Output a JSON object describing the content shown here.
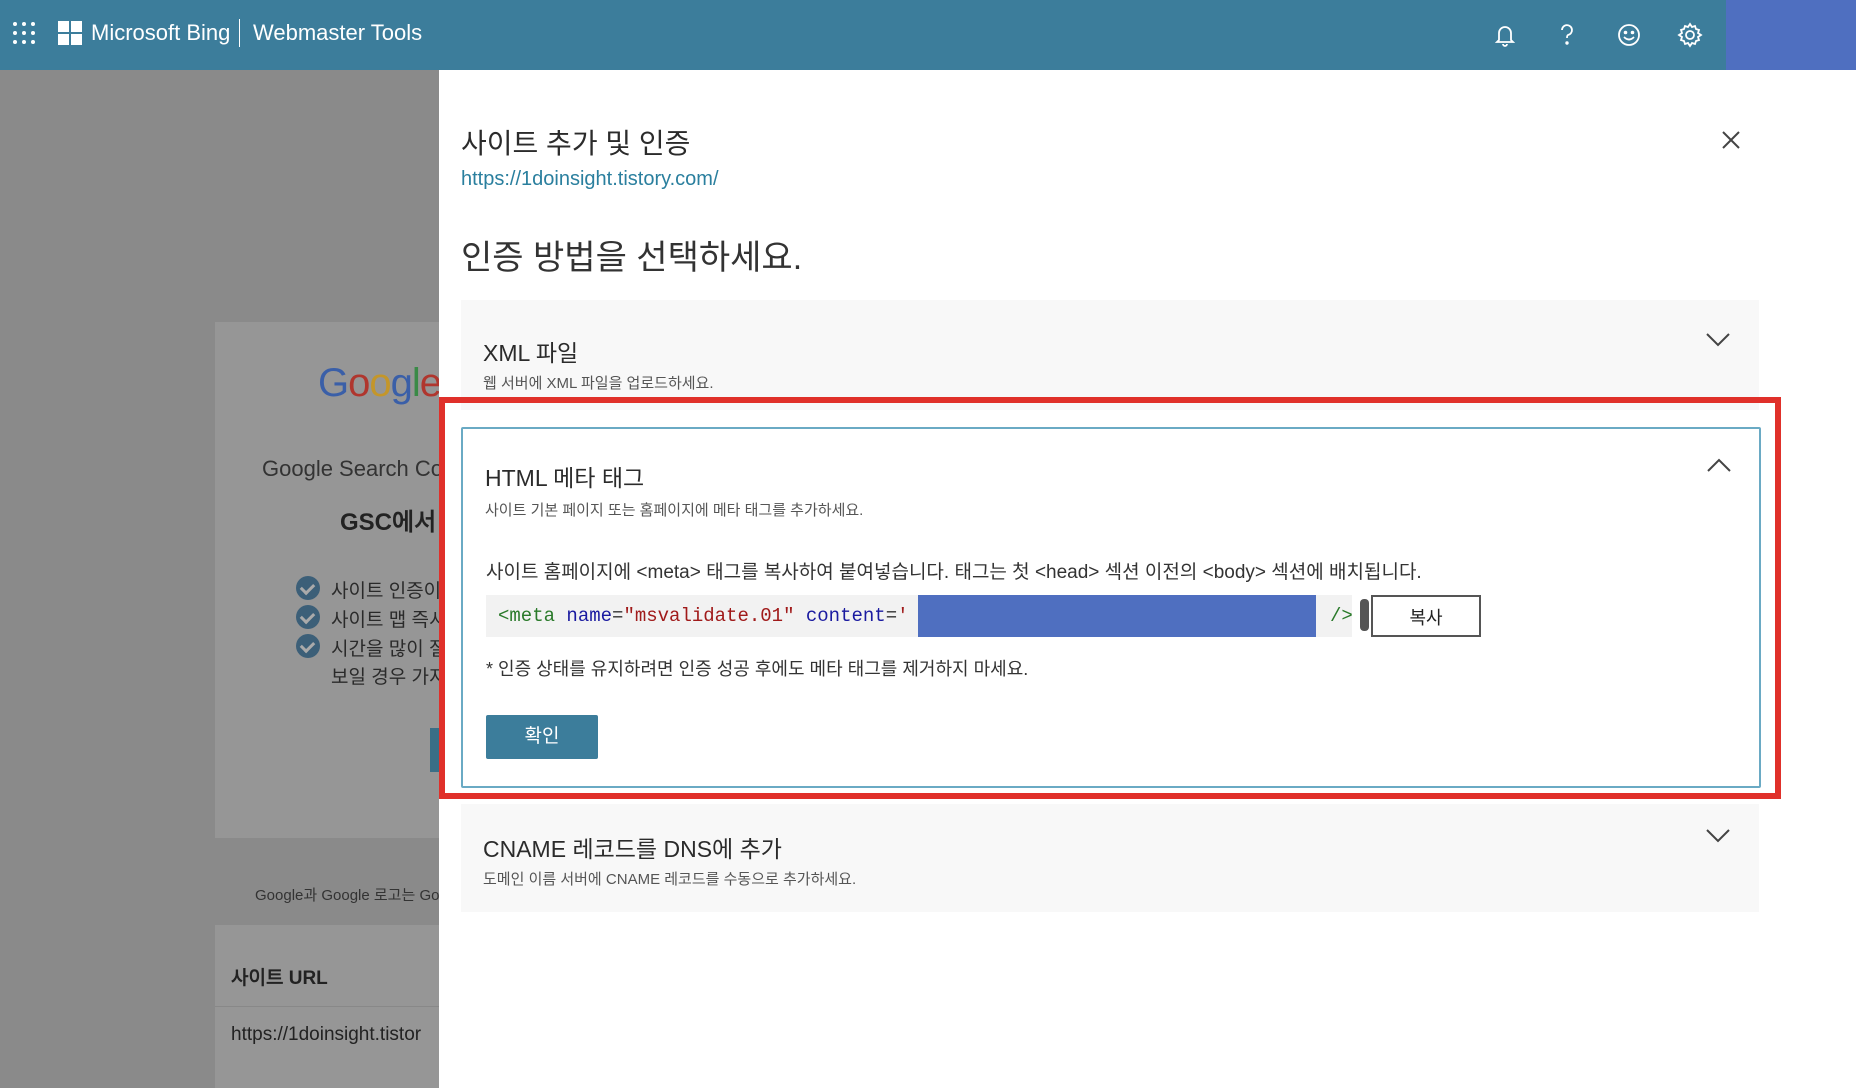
{
  "topbar": {
    "brand": "Microsoft Bing",
    "product": "Webmaster Tools",
    "icons": [
      "waffle-icon",
      "bell-icon",
      "help-icon",
      "smiley-icon",
      "gear-icon"
    ],
    "color": "#3c7d9b"
  },
  "background": {
    "google_logo": "Google",
    "gsc_title": "Google Search Co",
    "gsc_subtitle": "GSC에서",
    "bullets": [
      "사이트 인증이",
      "사이트 맵 즉시",
      "시간을 많이 절",
      "보일 경우 가져"
    ],
    "footer": "Google과 Google 로고는 Go",
    "table_header": "사이트 URL",
    "table_value": "https://1doinsight.tistor"
  },
  "panel": {
    "title": "사이트 추가 및 인증",
    "url": "https://1doinsight.tistory.com/",
    "heading": "인증 방법을 선택하세요.",
    "methods": [
      {
        "title": "XML 파일",
        "subtitle": "웹 서버에 XML 파일을 업로드하세요."
      },
      {
        "title": "HTML 메타 태그",
        "subtitle": "사이트 기본 페이지 또는 홈페이지에 메타 태그를 추가하세요."
      },
      {
        "title": "CNAME 레코드를 DNS에 추가",
        "subtitle": "도메인 이름 서버에 CNAME 레코드를 수동으로 추가하세요."
      }
    ],
    "meta": {
      "instruction": "사이트 홈페이지에 <meta> 태그를 복사하여 붙여넣습니다. 태그는 첫 <head> 섹션 이전의 <body> 섹션에 배치됩니다.",
      "code_tag": "<meta",
      "code_attr1": "name",
      "code_val1": "\"msvalidate.01\"",
      "code_attr2": "content",
      "code_val2_start": "'",
      "code_close": "/>",
      "copy_label": "복사",
      "note": "* 인증 상태를 유지하려면 인증 성공 후에도 메타 태그를 제거하지 마세요.",
      "confirm_label": "확인"
    }
  },
  "highlight_color": "#e0302a"
}
